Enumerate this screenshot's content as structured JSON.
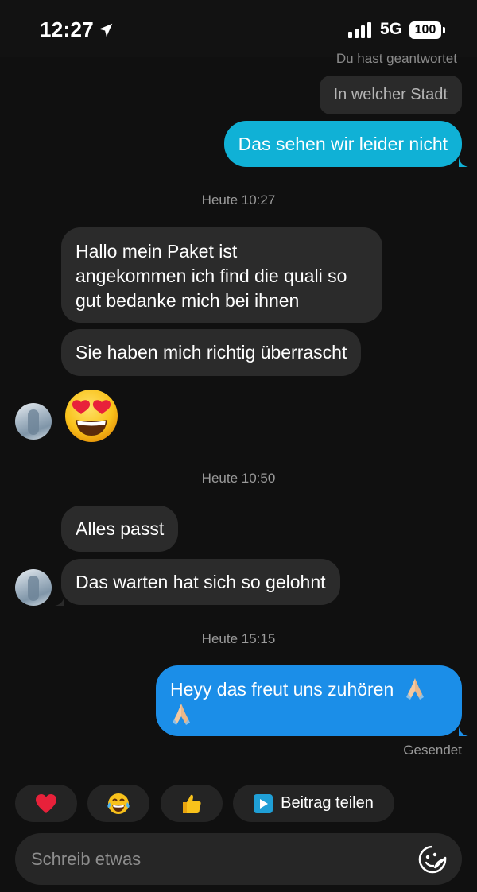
{
  "status_bar": {
    "time": "12:27",
    "network": "5G",
    "battery": "100"
  },
  "chat": {
    "reply_note": "Du hast geantwortet",
    "reply_quote": "In welcher Stadt",
    "outgoing_1": "Das sehen wir leider nicht",
    "timestamp_1": "Heute 10:27",
    "incoming_1_lines": [
      "Hallo  mein Paket ist",
      "angekommen ich find die quali so",
      "gut bedanke mich bei ihnen"
    ],
    "incoming_2": "Sie haben mich richtig überrascht",
    "big_emoji": "smiling-face-with-heart-eyes",
    "timestamp_2": "Heute 10:50",
    "incoming_3": "Alles passt",
    "incoming_4": "Das warten hat sich so gelohnt",
    "timestamp_3": "Heute 15:15",
    "outgoing_2_line1": "Heyy das freut uns zuhören",
    "sent_status": "Gesendet"
  },
  "quick_reactions": {
    "items": [
      "heart",
      "tears-of-joy",
      "thumbs-up"
    ],
    "share_label": "Beitrag teilen"
  },
  "composer": {
    "placeholder": "Schreib etwas"
  },
  "colors": {
    "background": "#101010",
    "incoming_bubble": "#2b2b2b",
    "outgoing_bubble_1": "#10b1d6",
    "outgoing_bubble_2": "#1b8ee8"
  }
}
